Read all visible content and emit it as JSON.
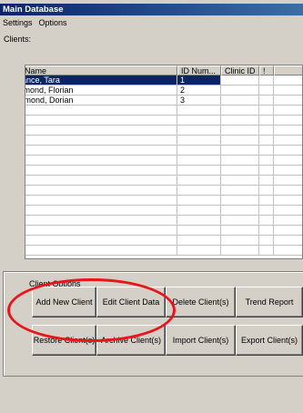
{
  "window": {
    "title": "Main Database"
  },
  "menu": {
    "items": [
      "Settings",
      "Options"
    ]
  },
  "clients": {
    "label": "Clients:",
    "columns": [
      "Full Name",
      "ID Num...",
      "Clinic ID",
      "!",
      ""
    ],
    "rows": [
      {
        "name": "Ballance, Tara",
        "id": "1",
        "clinic": "",
        "flag": "",
        "extra": ""
      },
      {
        "name": "Dorimond, Florian",
        "id": "2",
        "clinic": "",
        "flag": "",
        "extra": ""
      },
      {
        "name": "Florimond, Dorian",
        "id": "3",
        "clinic": "",
        "flag": "",
        "extra": ""
      }
    ],
    "selected_row": 0
  },
  "client_options": {
    "label": "Client Options",
    "buttons": {
      "add_new_client": "Add New Client",
      "edit_client_data": "Edit Client Data",
      "delete_clients": "Delete Client(s)",
      "trend_report": "Trend Report",
      "restore_clients": "Restore Client(s)",
      "archive_clients": "Archive Client(s)",
      "import_clients": "Import Client(s)",
      "export_clients": "Export Client(s)"
    }
  },
  "annotation": {
    "color": "#e8161b"
  }
}
